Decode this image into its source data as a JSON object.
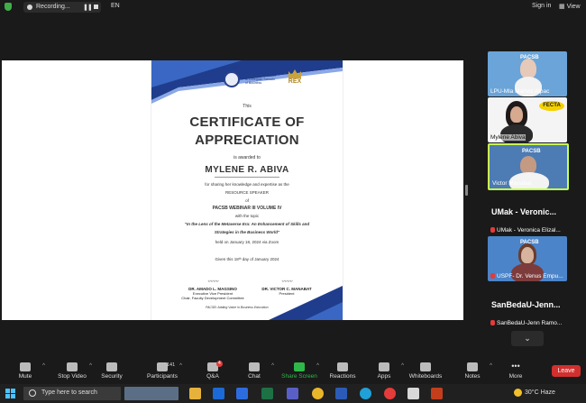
{
  "topbar": {
    "recording_label": "Recording...",
    "pause_glyph": "❚❚",
    "language": "EN",
    "sign_in": "Sign in",
    "view": "View"
  },
  "certificate": {
    "org_name": "Philippine Association of Collegiate Schools of Business",
    "partner_logo": "REX",
    "this": "This",
    "title_line1": "CERTIFICATE OF",
    "title_line2": "APPRECIATION",
    "awarded": "is awarded to",
    "recipient": "MYLENE R. ABIVA",
    "for_text": "for sharing her knowledge and expertise as the",
    "role": "RESOURCE SPEAKER",
    "of": "of",
    "event": "PACSB WEBINAR III VOLUME IV",
    "topic_intro": "with the topic",
    "topic_line1": "\"In the Lens of the Metaverse Era: An Enhancement of Skills and",
    "topic_line2": "Strategies in the Business World\"",
    "held": "held on January 18, 2024 via Zoom",
    "given": "Given this 18ᵗʰ day of January 2024",
    "signatory1_name": "DR. AMADO L. MAGSINO",
    "signatory1_title1": "Executive Vice President",
    "signatory1_title2": "Chair, Faculty Development Committee",
    "signatory2_name": "DR. VICTOR C. MANABAT",
    "signatory2_title": "President",
    "footer": "PACSB: Adding Value in Business Education"
  },
  "participants": [
    {
      "label": "LPU-Mla Marivic Alpac",
      "logo": "PACSB"
    },
    {
      "label": "Mylene Abiva",
      "logo": "FECTA"
    },
    {
      "label": "Victor Manabat",
      "logo": "PACSB"
    },
    {
      "big": "UMak - Veronic...",
      "label": "UMak - Veronica Elizal..."
    },
    {
      "label": "USPF- Dr. Venus Empu...",
      "logo": "PACSB"
    },
    {
      "big": "SanBedaU-Jenn...",
      "label": "SanBedaU-Jenn Ramo..."
    }
  ],
  "toolbar": {
    "mute": "Mute",
    "stop_video": "Stop Video",
    "security": "Security",
    "participants": "Participants",
    "participants_count": "141",
    "qa": "Q&A",
    "qa_badge": "4",
    "chat": "Chat",
    "share_screen": "Share Screen",
    "reactions": "Reactions",
    "apps": "Apps",
    "whiteboards": "Whiteboards",
    "notes": "Notes",
    "more": "More",
    "leave": "Leave"
  },
  "taskbar": {
    "search_placeholder": "Type here to search",
    "weather": "30°C  Haze"
  },
  "colors": {
    "accent_green": "#2fb84a",
    "leave_red": "#d22f2f",
    "cert_purple": "#3b2a78",
    "cert_blue": "#27418a"
  }
}
